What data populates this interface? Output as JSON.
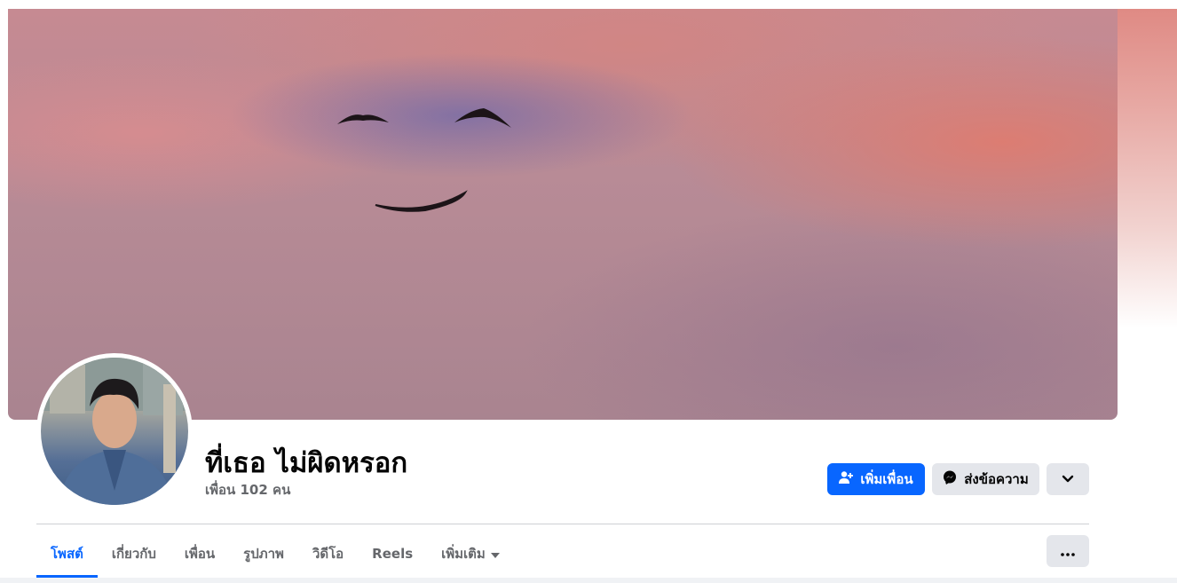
{
  "profile": {
    "name": "ที่เธอ ไม่ผิดหรอก",
    "friends_count": "เพื่อน 102 คน"
  },
  "actions": {
    "add_friend_label": "เพิ่มเพื่อน",
    "message_label": "ส่งข้อความ"
  },
  "tabs": [
    {
      "label": "โพสต์",
      "active": true
    },
    {
      "label": "เกี่ยวกับ"
    },
    {
      "label": "เพื่อน"
    },
    {
      "label": "รูปภาพ"
    },
    {
      "label": "วิดีโอ"
    },
    {
      "label": "Reels"
    },
    {
      "label": "เพิ่มเติม"
    }
  ],
  "colors": {
    "accent": "#0866ff",
    "secondary_button": "#e4e6eb",
    "muted_text": "#65676b"
  },
  "icons": {
    "add_friend": "person-plus-icon",
    "message": "messenger-icon",
    "more": "chevron-down-icon",
    "tab_more": "caret-down-icon",
    "options": "ellipsis-icon"
  }
}
